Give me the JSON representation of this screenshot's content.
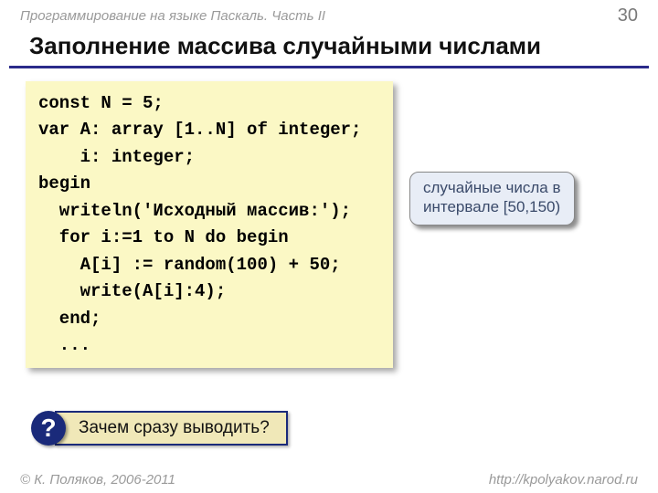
{
  "header": {
    "course": "Программирование на языке Паскаль. Часть II",
    "page": "30"
  },
  "title": "Заполнение массива случайными числами",
  "code": {
    "l1": "const N = 5;",
    "l2": "var A: array [1..N] of integer;",
    "l3": "    i: integer;",
    "l4": "begin",
    "l5": "  writeln('Исходный массив:');",
    "l6": "  for i:=1 to N do begin",
    "l7": "    A[i] := random(100) + 50;",
    "l8": "    write(A[i]:4);",
    "l9": "  end;",
    "l10": "  ..."
  },
  "callout": {
    "line1": "случайные числа в",
    "line2": "интервале [50,150)"
  },
  "question": {
    "mark": "?",
    "text": "Зачем сразу выводить?"
  },
  "footer": {
    "copyright": "© К. Поляков, 2006-2011",
    "url": "http://kpolyakov.narod.ru"
  }
}
